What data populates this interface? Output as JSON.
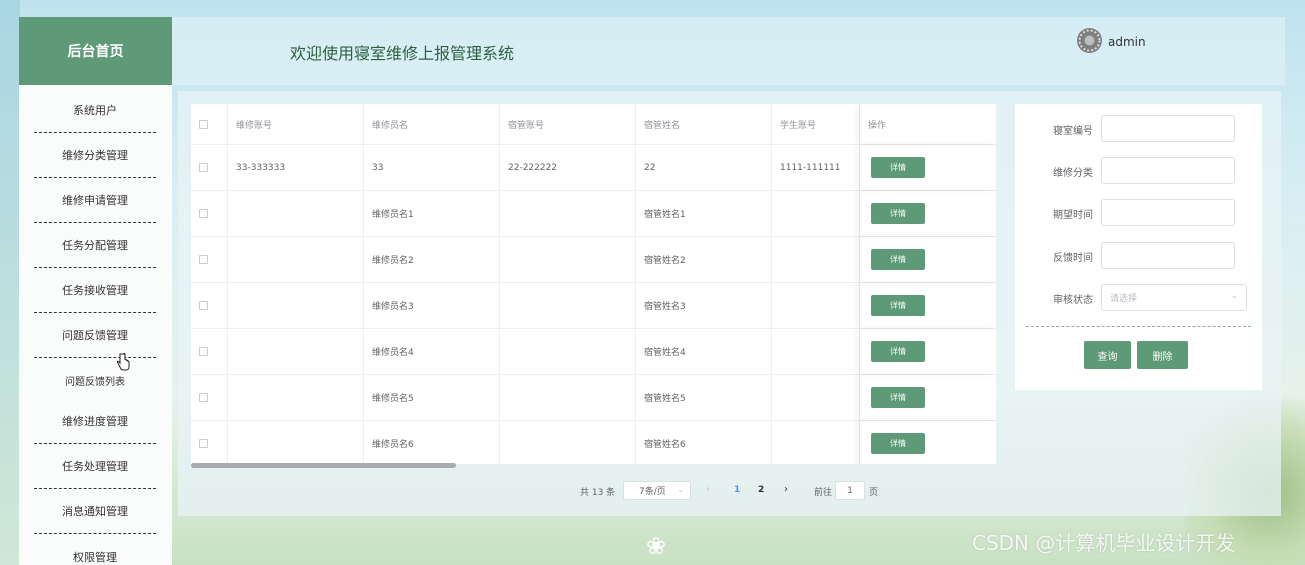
{
  "sidebar": {
    "home_label": "后台首页",
    "items": [
      {
        "label": "系统用户"
      },
      {
        "label": "维修分类管理"
      },
      {
        "label": "维修申请管理"
      },
      {
        "label": "任务分配管理"
      },
      {
        "label": "任务接收管理"
      },
      {
        "label": "问题反馈管理"
      },
      {
        "label": "问题反馈列表"
      },
      {
        "label": "维修进度管理"
      },
      {
        "label": "任务处理管理"
      },
      {
        "label": "消息通知管理"
      },
      {
        "label": "权限管理"
      }
    ]
  },
  "header": {
    "title": "欢迎使用寝室维修上报管理系统",
    "user": "admin"
  },
  "table": {
    "columns": [
      "维修账号",
      "维修员名",
      "宿管账号",
      "宿管姓名",
      "学生账号",
      "操作"
    ],
    "detail_label": "详情",
    "rows": [
      {
        "repair_account": "33-333333",
        "repairer_name": "33",
        "manager_account": "22-222222",
        "manager_name": "22",
        "student_account": "1111-111111"
      },
      {
        "repair_account": "",
        "repairer_name": "维修员名1",
        "manager_account": "",
        "manager_name": "宿管姓名1",
        "student_account": ""
      },
      {
        "repair_account": "",
        "repairer_name": "维修员名2",
        "manager_account": "",
        "manager_name": "宿管姓名2",
        "student_account": ""
      },
      {
        "repair_account": "",
        "repairer_name": "维修员名3",
        "manager_account": "",
        "manager_name": "宿管姓名3",
        "student_account": ""
      },
      {
        "repair_account": "",
        "repairer_name": "维修员名4",
        "manager_account": "",
        "manager_name": "宿管姓名4",
        "student_account": ""
      },
      {
        "repair_account": "",
        "repairer_name": "维修员名5",
        "manager_account": "",
        "manager_name": "宿管姓名5",
        "student_account": ""
      },
      {
        "repair_account": "",
        "repairer_name": "维修员名6",
        "manager_account": "",
        "manager_name": "宿管姓名6",
        "student_account": ""
      }
    ]
  },
  "pagination": {
    "total": "共 13 条",
    "page_size": "7条/页",
    "pages": [
      "1",
      "2"
    ],
    "current_page": "1",
    "goto_label": "前往",
    "goto_value": "1",
    "page_suffix": "页"
  },
  "search_form": {
    "fields": [
      {
        "label": "寝室编号",
        "value": ""
      },
      {
        "label": "维修分类",
        "value": ""
      },
      {
        "label": "期望时间",
        "value": ""
      },
      {
        "label": "反馈时间",
        "value": ""
      }
    ],
    "status_label": "审核状态",
    "status_placeholder": "请选择",
    "search_button": "查询",
    "delete_button": "删除"
  },
  "watermark": "CSDN @计算机毕业设计开发",
  "colors": {
    "primary_green": "#5e9a78",
    "page_link_blue": "#409eff"
  }
}
